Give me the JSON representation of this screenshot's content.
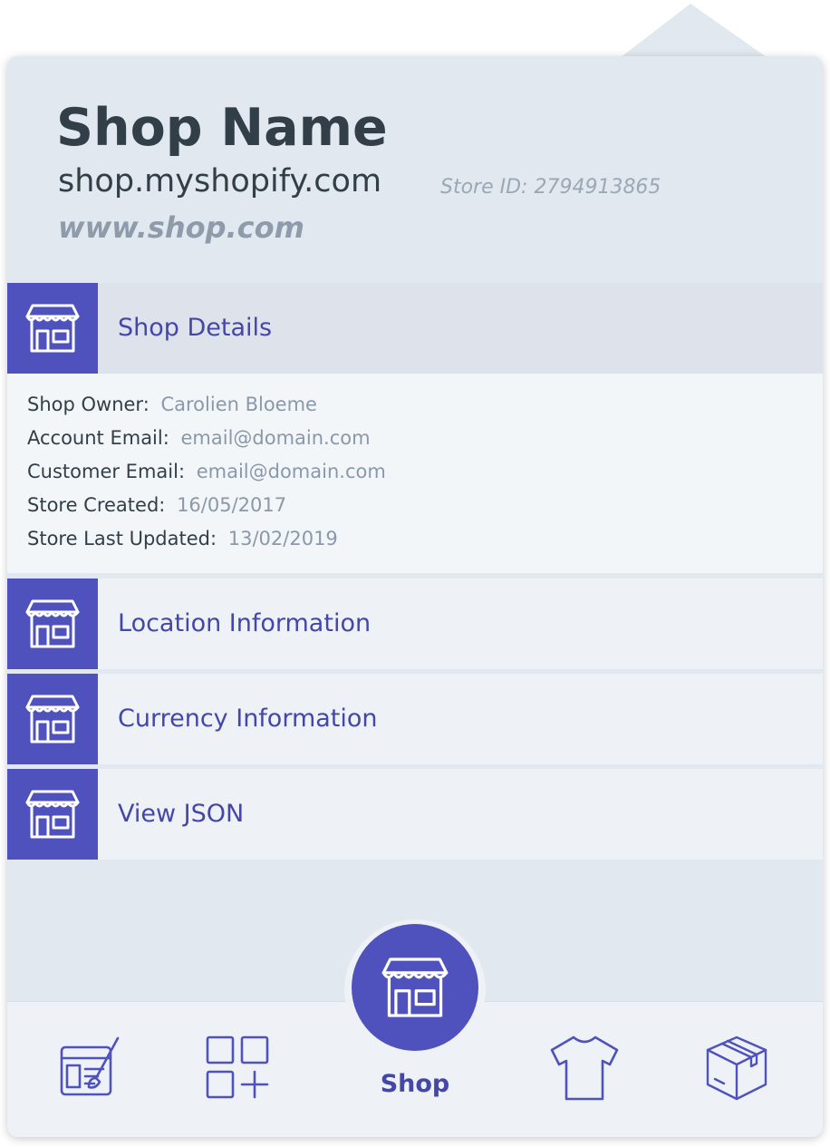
{
  "header": {
    "title": "Shop Name",
    "domain": "shop.myshopify.com",
    "store_id": "Store ID: 2794913865",
    "website": "www.shop.com"
  },
  "sections": [
    {
      "label": "Shop Details",
      "icon": "store-icon",
      "expanded": true
    },
    {
      "label": "Location Information",
      "icon": "store-icon"
    },
    {
      "label": "Currency Information",
      "icon": "store-icon"
    },
    {
      "label": "View JSON",
      "icon": "store-icon"
    }
  ],
  "details": [
    {
      "label": "Shop Owner:",
      "value": "Carolien Bloeme"
    },
    {
      "label": "Account Email:",
      "value": "email@domain.com"
    },
    {
      "label": "Customer Email:",
      "value": "email@domain.com"
    },
    {
      "label": "Store Created:",
      "value": "16/05/2017"
    },
    {
      "label": "Store Last Updated:",
      "value": "13/02/2019"
    }
  ],
  "tabbar": {
    "active_label": "Shop",
    "tabs": [
      "theme-editor-icon",
      "add-apps-icon",
      "store-icon",
      "t-shirt-icon",
      "box-icon"
    ]
  },
  "colors": {
    "accent": "#4f52bc",
    "accent_text": "#4446a8",
    "card_bg": "#e1e8ef",
    "title_text": "#323e48",
    "muted_text": "#8a98a8"
  }
}
